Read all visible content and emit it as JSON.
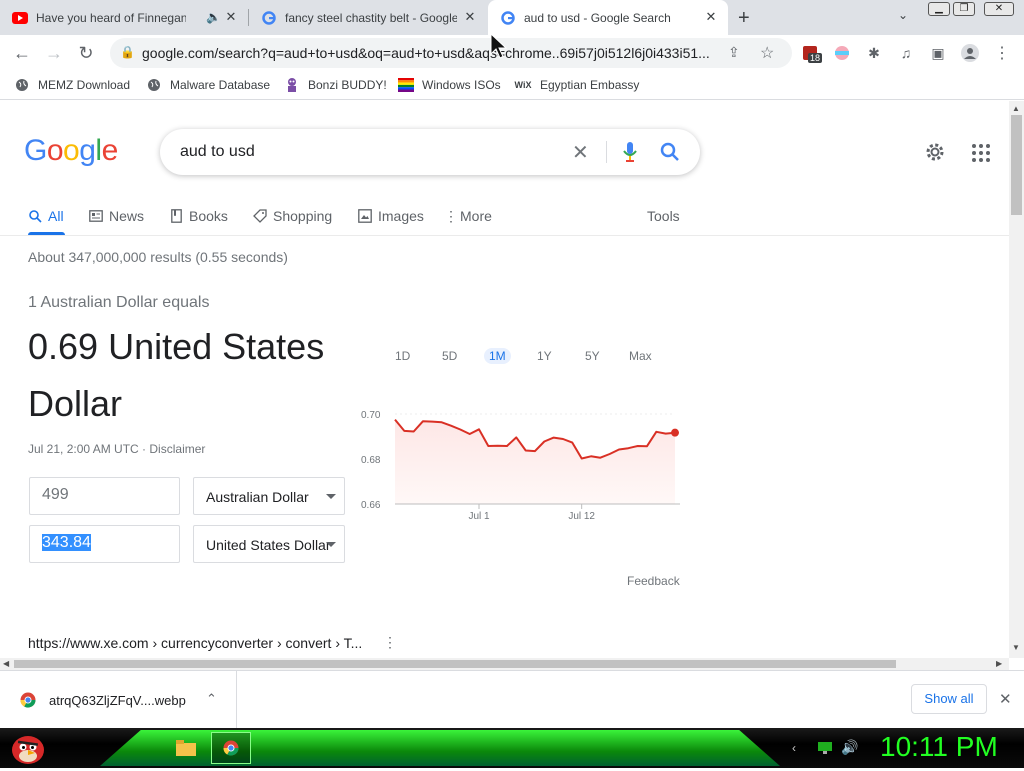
{
  "browser": {
    "tabs": [
      {
        "title": "Have you heard of Finnegan",
        "favicon": "youtube-icon"
      },
      {
        "title": "fancy steel chastity belt - Google",
        "favicon": "google-icon"
      },
      {
        "title": "aud to usd - Google Search",
        "favicon": "google-icon"
      }
    ],
    "url": "google.com/search?q=aud+to+usd&oq=aud+to+usd&aqs=chrome..69i57j0i512l6j0i433i51...",
    "extension_badge": "18",
    "bookmarks": [
      {
        "label": "MEMZ Download"
      },
      {
        "label": "Malware Database"
      },
      {
        "label": "Bonzi BUDDY!"
      },
      {
        "label": "Windows ISOs"
      },
      {
        "label": "Egyptian Embassy"
      }
    ]
  },
  "search": {
    "query": "aud to usd",
    "tabs": [
      "All",
      "News",
      "Books",
      "Shopping",
      "Images",
      "More"
    ],
    "tools_label": "Tools",
    "result_stats": "About 347,000,000 results (0.55 seconds)"
  },
  "converter": {
    "equals_label": "1 Australian Dollar equals",
    "rate_line1": "0.69 United States",
    "rate_line2": "Dollar",
    "timestamp": "Jul 21, 2:00 AM UTC · ",
    "disclaimer": "Disclaimer",
    "from_amount": "499",
    "from_currency": "Australian Dollar",
    "to_amount": "343.84",
    "to_currency": "United States Dollar",
    "feedback": "Feedback",
    "ranges": [
      "1D",
      "5D",
      "1M",
      "1Y",
      "5Y",
      "Max"
    ],
    "selected_range": "1M"
  },
  "chart_data": {
    "type": "area",
    "yticks": [
      "0.70",
      "0.68",
      "0.66"
    ],
    "xticks": [
      "Jul 1",
      "Jul 12"
    ],
    "ylim": [
      0.66,
      0.7
    ],
    "y": [
      0.6975,
      0.6925,
      0.6922,
      0.6968,
      0.6966,
      0.6963,
      0.6948,
      0.6931,
      0.6911,
      0.6932,
      0.6858,
      0.6859,
      0.6858,
      0.6896,
      0.6838,
      0.6835,
      0.6878,
      0.6895,
      0.6889,
      0.6873,
      0.6802,
      0.6812,
      0.6806,
      0.6822,
      0.6842,
      0.6848,
      0.6858,
      0.6857,
      0.6921,
      0.6913,
      0.6917
    ],
    "line_color": "#d93025",
    "fill_color": "#fde7e6"
  },
  "result": {
    "breadcrumb": "https://www.xe.com › currencyconverter › convert › T..."
  },
  "downloads": {
    "filename": "atrqQ63ZljZFqV....webp",
    "show_all": "Show all"
  },
  "taskbar": {
    "clock": "10:11 PM"
  }
}
